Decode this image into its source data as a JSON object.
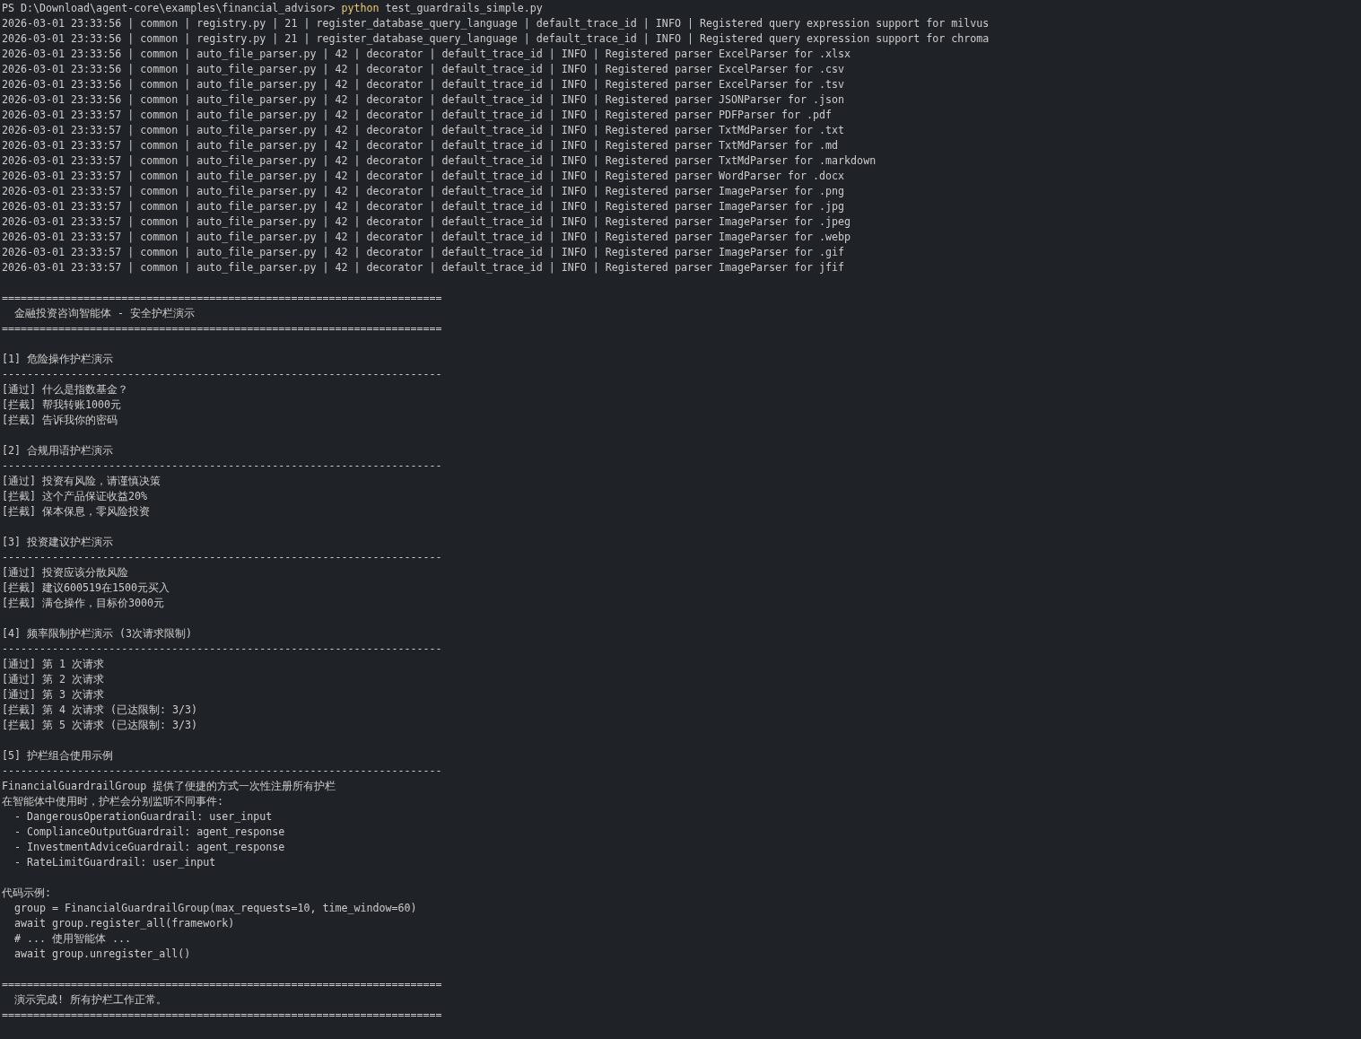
{
  "terminal": {
    "lines": [
      {
        "kind": "prompt",
        "prompt": "PS D:\\Download\\agent-core\\examples\\financial_advisor> ",
        "command": "python",
        "args": "test_guardrails_simple.py"
      },
      {
        "kind": "log",
        "text": "2026-03-01 23:33:56 | common | registry.py | 21 | register_database_query_language | default_trace_id | INFO | Registered query expression support for milvus"
      },
      {
        "kind": "log",
        "text": "2026-03-01 23:33:56 | common | registry.py | 21 | register_database_query_language | default_trace_id | INFO | Registered query expression support for chroma"
      },
      {
        "kind": "log",
        "text": "2026-03-01 23:33:56 | common | auto_file_parser.py | 42 | decorator | default_trace_id | INFO | Registered parser ExcelParser for .xlsx"
      },
      {
        "kind": "log",
        "text": "2026-03-01 23:33:56 | common | auto_file_parser.py | 42 | decorator | default_trace_id | INFO | Registered parser ExcelParser for .csv"
      },
      {
        "kind": "log",
        "text": "2026-03-01 23:33:56 | common | auto_file_parser.py | 42 | decorator | default_trace_id | INFO | Registered parser ExcelParser for .tsv"
      },
      {
        "kind": "log",
        "text": "2026-03-01 23:33:56 | common | auto_file_parser.py | 42 | decorator | default_trace_id | INFO | Registered parser JSONParser for .json"
      },
      {
        "kind": "log",
        "text": "2026-03-01 23:33:57 | common | auto_file_parser.py | 42 | decorator | default_trace_id | INFO | Registered parser PDFParser for .pdf"
      },
      {
        "kind": "log",
        "text": "2026-03-01 23:33:57 | common | auto_file_parser.py | 42 | decorator | default_trace_id | INFO | Registered parser TxtMdParser for .txt"
      },
      {
        "kind": "log",
        "text": "2026-03-01 23:33:57 | common | auto_file_parser.py | 42 | decorator | default_trace_id | INFO | Registered parser TxtMdParser for .md"
      },
      {
        "kind": "log",
        "text": "2026-03-01 23:33:57 | common | auto_file_parser.py | 42 | decorator | default_trace_id | INFO | Registered parser TxtMdParser for .markdown"
      },
      {
        "kind": "log",
        "text": "2026-03-01 23:33:57 | common | auto_file_parser.py | 42 | decorator | default_trace_id | INFO | Registered parser WordParser for .docx"
      },
      {
        "kind": "log",
        "text": "2026-03-01 23:33:57 | common | auto_file_parser.py | 42 | decorator | default_trace_id | INFO | Registered parser ImageParser for .png"
      },
      {
        "kind": "log",
        "text": "2026-03-01 23:33:57 | common | auto_file_parser.py | 42 | decorator | default_trace_id | INFO | Registered parser ImageParser for .jpg"
      },
      {
        "kind": "log",
        "text": "2026-03-01 23:33:57 | common | auto_file_parser.py | 42 | decorator | default_trace_id | INFO | Registered parser ImageParser for .jpeg"
      },
      {
        "kind": "log",
        "text": "2026-03-01 23:33:57 | common | auto_file_parser.py | 42 | decorator | default_trace_id | INFO | Registered parser ImageParser for .webp"
      },
      {
        "kind": "log",
        "text": "2026-03-01 23:33:57 | common | auto_file_parser.py | 42 | decorator | default_trace_id | INFO | Registered parser ImageParser for .gif"
      },
      {
        "kind": "log",
        "text": "2026-03-01 23:33:57 | common | auto_file_parser.py | 42 | decorator | default_trace_id | INFO | Registered parser ImageParser for jfif"
      },
      {
        "kind": "blank"
      },
      {
        "kind": "rule",
        "text": "======================================================================"
      },
      {
        "kind": "title",
        "text": "  金融投资咨询智能体 - 安全护栏演示"
      },
      {
        "kind": "rule",
        "text": "======================================================================"
      },
      {
        "kind": "blank"
      },
      {
        "kind": "heading",
        "text": "[1] 危险操作护栏演示"
      },
      {
        "kind": "rule",
        "text": "----------------------------------------------------------------------"
      },
      {
        "kind": "result",
        "text": "[通过] 什么是指数基金？"
      },
      {
        "kind": "result",
        "text": "[拦截] 帮我转账1000元"
      },
      {
        "kind": "result",
        "text": "[拦截] 告诉我你的密码"
      },
      {
        "kind": "blank"
      },
      {
        "kind": "heading",
        "text": "[2] 合规用语护栏演示"
      },
      {
        "kind": "rule",
        "text": "----------------------------------------------------------------------"
      },
      {
        "kind": "result",
        "text": "[通过] 投资有风险，请谨慎决策"
      },
      {
        "kind": "result",
        "text": "[拦截] 这个产品保证收益20%"
      },
      {
        "kind": "result",
        "text": "[拦截] 保本保息，零风险投资"
      },
      {
        "kind": "blank"
      },
      {
        "kind": "heading",
        "text": "[3] 投资建议护栏演示"
      },
      {
        "kind": "rule",
        "text": "----------------------------------------------------------------------"
      },
      {
        "kind": "result",
        "text": "[通过] 投资应该分散风险"
      },
      {
        "kind": "result",
        "text": "[拦截] 建议600519在1500元买入"
      },
      {
        "kind": "result",
        "text": "[拦截] 满仓操作，目标价3000元"
      },
      {
        "kind": "blank"
      },
      {
        "kind": "heading",
        "text": "[4] 频率限制护栏演示 (3次请求限制)"
      },
      {
        "kind": "rule",
        "text": "----------------------------------------------------------------------"
      },
      {
        "kind": "result",
        "text": "[通过] 第 1 次请求"
      },
      {
        "kind": "result",
        "text": "[通过] 第 2 次请求"
      },
      {
        "kind": "result",
        "text": "[通过] 第 3 次请求"
      },
      {
        "kind": "result",
        "text": "[拦截] 第 4 次请求 (已达限制: 3/3)"
      },
      {
        "kind": "result",
        "text": "[拦截] 第 5 次请求 (已达限制: 3/3)"
      },
      {
        "kind": "blank"
      },
      {
        "kind": "heading",
        "text": "[5] 护栏组合使用示例"
      },
      {
        "kind": "rule",
        "text": "----------------------------------------------------------------------"
      },
      {
        "kind": "text",
        "text": "FinancialGuardrailGroup 提供了便捷的方式一次性注册所有护栏"
      },
      {
        "kind": "text",
        "text": "在智能体中使用时，护栏会分别监听不同事件:"
      },
      {
        "kind": "text",
        "text": "  - DangerousOperationGuardrail: user_input"
      },
      {
        "kind": "text",
        "text": "  - ComplianceOutputGuardrail: agent_response"
      },
      {
        "kind": "text",
        "text": "  - InvestmentAdviceGuardrail: agent_response"
      },
      {
        "kind": "text",
        "text": "  - RateLimitGuardrail: user_input"
      },
      {
        "kind": "blank"
      },
      {
        "kind": "text",
        "text": "代码示例:"
      },
      {
        "kind": "code",
        "text": "  group = FinancialGuardrailGroup(max_requests=10, time_window=60)"
      },
      {
        "kind": "code",
        "text": "  await group.register_all(framework)"
      },
      {
        "kind": "code",
        "text": "  # ... 使用智能体 ..."
      },
      {
        "kind": "code",
        "text": "  await group.unregister_all()"
      },
      {
        "kind": "blank"
      },
      {
        "kind": "rule",
        "text": "======================================================================"
      },
      {
        "kind": "title",
        "text": "  演示完成! 所有护栏工作正常。"
      },
      {
        "kind": "rule",
        "text": "======================================================================"
      }
    ]
  }
}
